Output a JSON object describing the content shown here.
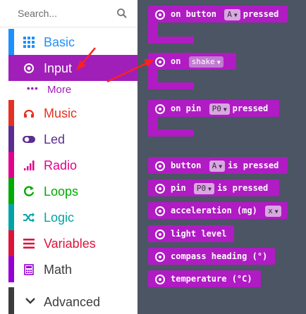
{
  "search": {
    "placeholder": "Search..."
  },
  "categories": [
    {
      "label": "Basic",
      "color": "#1e90ff",
      "icon": "grid-icon"
    },
    {
      "label": "Input",
      "color": "#a01fb8",
      "icon": "circle-dot-icon"
    },
    {
      "label": "Music",
      "color": "#e63022",
      "icon": "headphones-icon"
    },
    {
      "label": "Led",
      "color": "#5c2d91",
      "icon": "toggle-icon"
    },
    {
      "label": "Radio",
      "color": "#e3008c",
      "icon": "signal-icon"
    },
    {
      "label": "Loops",
      "color": "#00aa00",
      "icon": "refresh-icon"
    },
    {
      "label": "Logic",
      "color": "#00a4a6",
      "icon": "shuffle-icon"
    },
    {
      "label": "Variables",
      "color": "#dc143c",
      "icon": "list-icon"
    },
    {
      "label": "Math",
      "color": "#9400d3",
      "icon": "calculator-icon"
    }
  ],
  "more": {
    "label": "More",
    "dots": "•••"
  },
  "advanced": {
    "label": "Advanced"
  },
  "blocks": {
    "on_button": {
      "prefix": "on button",
      "dropdown": "A",
      "suffix": "pressed"
    },
    "on_gesture": {
      "prefix": "on",
      "dropdown": "shake"
    },
    "on_pin": {
      "prefix": "on pin",
      "dropdown": "P0",
      "suffix": "pressed"
    },
    "button_is_pressed": {
      "prefix": "button",
      "dropdown": "A",
      "suffix": "is pressed"
    },
    "pin_is_pressed": {
      "prefix": "pin",
      "dropdown": "P0",
      "suffix": "is pressed"
    },
    "acceleration": {
      "prefix": "acceleration (mg)",
      "dropdown": "x"
    },
    "light_level": {
      "label": "light level"
    },
    "compass": {
      "label": "compass heading (°)"
    },
    "temperature": {
      "label": "temperature (°C)"
    }
  }
}
